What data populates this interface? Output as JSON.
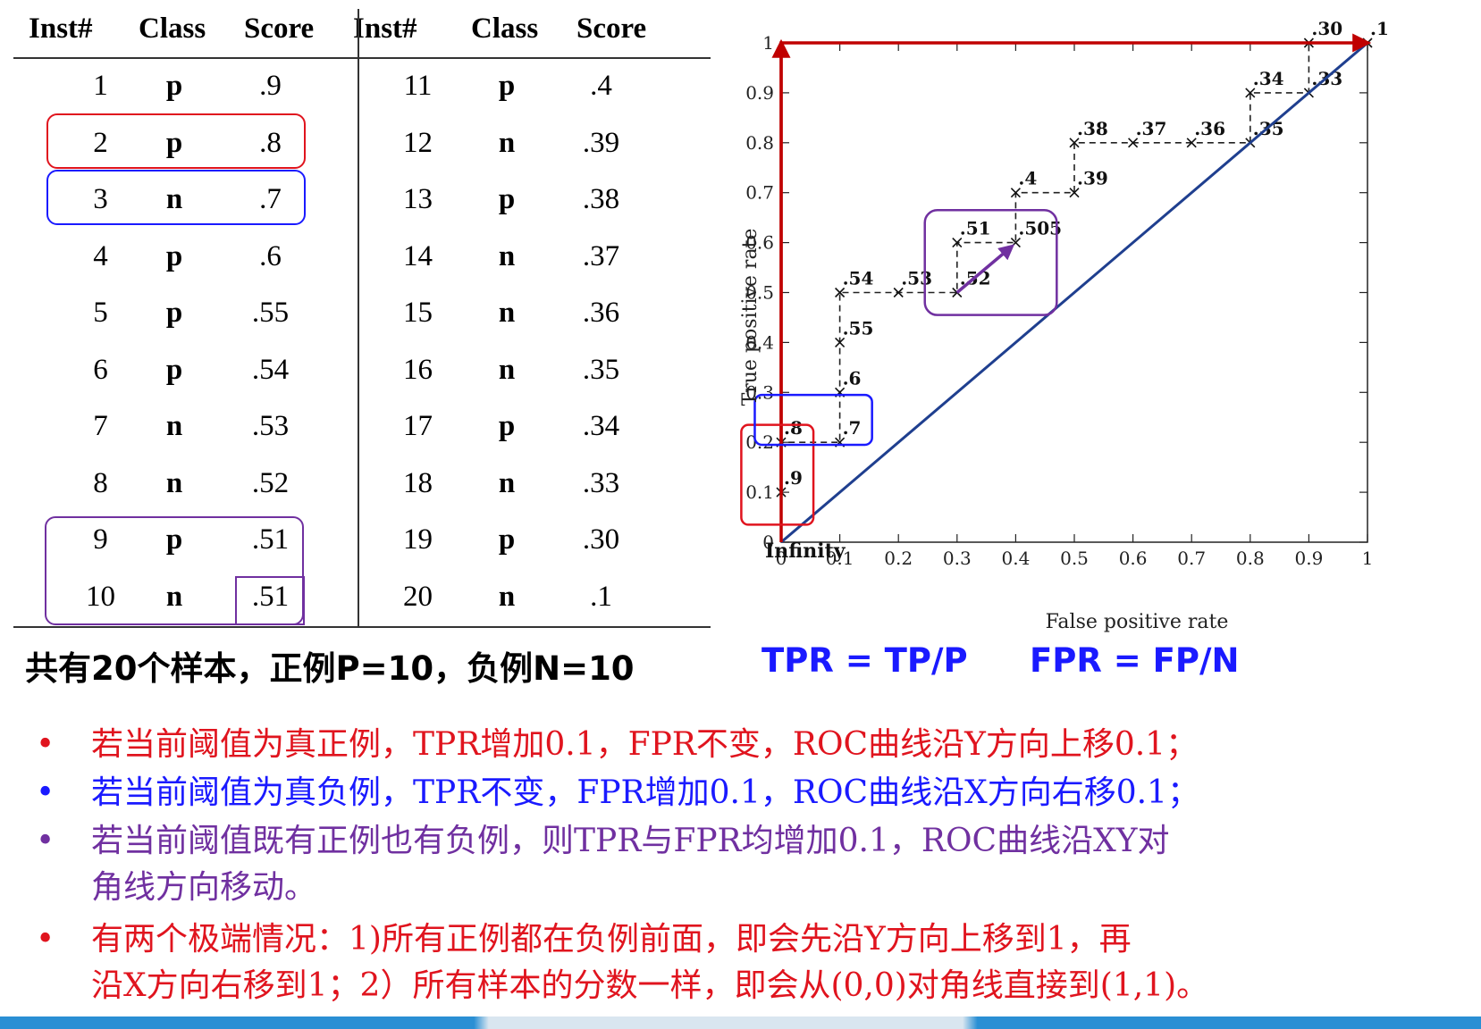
{
  "table": {
    "headers": [
      "Inst#",
      "Class",
      "Score",
      "Inst#",
      "Class",
      "Score"
    ],
    "rows": [
      {
        "inst": "1",
        "cls": "p",
        "score": ".9"
      },
      {
        "inst": "2",
        "cls": "p",
        "score": ".8"
      },
      {
        "inst": "3",
        "cls": "n",
        "score": ".7"
      },
      {
        "inst": "4",
        "cls": "p",
        "score": ".6"
      },
      {
        "inst": "5",
        "cls": "p",
        "score": ".55"
      },
      {
        "inst": "6",
        "cls": "p",
        "score": ".54"
      },
      {
        "inst": "7",
        "cls": "n",
        "score": ".53"
      },
      {
        "inst": "8",
        "cls": "n",
        "score": ".52"
      },
      {
        "inst": "9",
        "cls": "p",
        "score": ".51"
      },
      {
        "inst": "10",
        "cls": "n",
        "score": ".51"
      },
      {
        "inst": "11",
        "cls": "p",
        "score": ".4"
      },
      {
        "inst": "12",
        "cls": "n",
        "score": ".39"
      },
      {
        "inst": "13",
        "cls": "p",
        "score": ".38"
      },
      {
        "inst": "14",
        "cls": "n",
        "score": ".37"
      },
      {
        "inst": "15",
        "cls": "n",
        "score": ".36"
      },
      {
        "inst": "16",
        "cls": "n",
        "score": ".35"
      },
      {
        "inst": "17",
        "cls": "p",
        "score": ".34"
      },
      {
        "inst": "18",
        "cls": "n",
        "score": ".33"
      },
      {
        "inst": "19",
        "cls": "p",
        "score": ".30"
      },
      {
        "inst": "20",
        "cls": "n",
        "score": ".1"
      }
    ]
  },
  "summary": "共有20个样本，正例P=10，负例N=10",
  "formulas": {
    "tpr": "TPR = TP/P",
    "fpr": "FPR = FP/N"
  },
  "colors": {
    "red": "#e0141e",
    "blue": "#1a1aff",
    "purple": "#7030a0",
    "dark_red": "#c00000",
    "navy": "#1f3f8f"
  },
  "bullets": [
    {
      "color": "red",
      "lines": [
        "若当前阈值为真正例，TPR增加0.1，FPR不变，ROC曲线沿Y方向上移0.1；"
      ]
    },
    {
      "color": "blue",
      "lines": [
        "若当前阈值为真负例，TPR不变，FPR增加0.1，ROC曲线沿X方向右移0.1；"
      ]
    },
    {
      "color": "purple",
      "lines": [
        "若当前阈值既有正例也有负例，则TPR与FPR均增加0.1，ROC曲线沿XY对",
        "角线方向移动。"
      ]
    },
    {
      "color": "red",
      "lines": [
        "有两个极端情况：1)所有正例都在负例前面，即会先沿Y方向上移到1，再",
        "沿X方向右移到1；2）所有样本的分数一样，即会从(0,0)对角线直接到(1,1)。"
      ]
    }
  ],
  "chart_data": {
    "type": "line",
    "xlabel": "False positive rate",
    "ylabel": "True positive rate",
    "xlim": [
      0,
      1
    ],
    "ylim": [
      0,
      1
    ],
    "x_ticks": [
      "0",
      "0.1",
      "0.2",
      "0.3",
      "0.4",
      "0.5",
      "0.6",
      "0.7",
      "0.8",
      "0.9",
      "1"
    ],
    "y_ticks": [
      "0",
      "0.1",
      "0.2",
      "0.3",
      "0.4",
      "0.5",
      "0.6",
      "0.7",
      "0.8",
      "0.9",
      "1"
    ],
    "origin_label": "Infinity",
    "roc_points": [
      {
        "x": 0.0,
        "y": 0.1,
        "label": ".9"
      },
      {
        "x": 0.0,
        "y": 0.2,
        "label": ".8"
      },
      {
        "x": 0.1,
        "y": 0.2,
        "label": ".7"
      },
      {
        "x": 0.1,
        "y": 0.3,
        "label": ".6"
      },
      {
        "x": 0.1,
        "y": 0.4,
        "label": ".55"
      },
      {
        "x": 0.1,
        "y": 0.5,
        "label": ".54"
      },
      {
        "x": 0.2,
        "y": 0.5,
        "label": ".53"
      },
      {
        "x": 0.3,
        "y": 0.5,
        "label": ".52"
      },
      {
        "x": 0.3,
        "y": 0.6,
        "label": ".51"
      },
      {
        "x": 0.4,
        "y": 0.6,
        "label": ".505"
      },
      {
        "x": 0.4,
        "y": 0.7,
        "label": ".4"
      },
      {
        "x": 0.5,
        "y": 0.7,
        "label": ".39"
      },
      {
        "x": 0.5,
        "y": 0.8,
        "label": ".38"
      },
      {
        "x": 0.6,
        "y": 0.8,
        "label": ".37"
      },
      {
        "x": 0.7,
        "y": 0.8,
        "label": ".36"
      },
      {
        "x": 0.8,
        "y": 0.8,
        "label": ".35"
      },
      {
        "x": 0.8,
        "y": 0.9,
        "label": ".34"
      },
      {
        "x": 0.9,
        "y": 0.9,
        "label": ".33"
      },
      {
        "x": 0.9,
        "y": 1.0,
        "label": ".30"
      },
      {
        "x": 1.0,
        "y": 1.0,
        "label": ".1"
      }
    ]
  }
}
